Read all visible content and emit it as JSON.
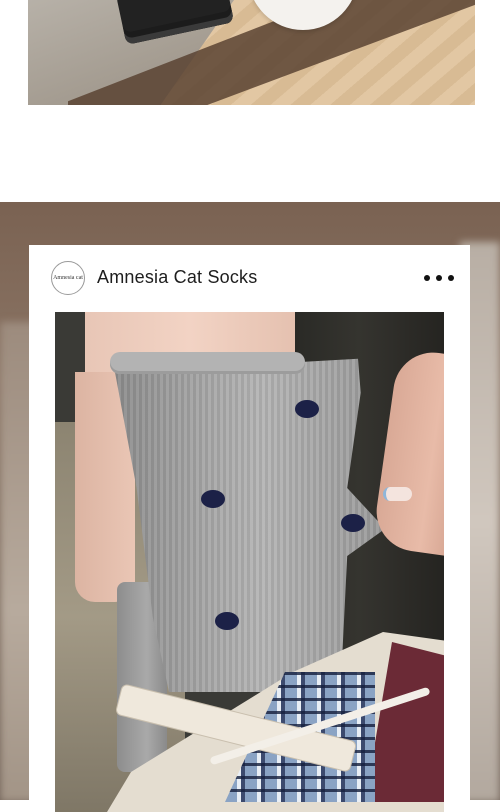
{
  "post": {
    "avatar_text": "Amnesia cat",
    "brand_name": "Amnesia Cat Socks"
  },
  "icons": {
    "more": "more-horizontal-icon"
  },
  "colors": {
    "page_background": "#ffffff",
    "card_background": "#ffffff",
    "sock_gray": "#a9a9a9",
    "sock_dot_navy": "#1c2147"
  }
}
